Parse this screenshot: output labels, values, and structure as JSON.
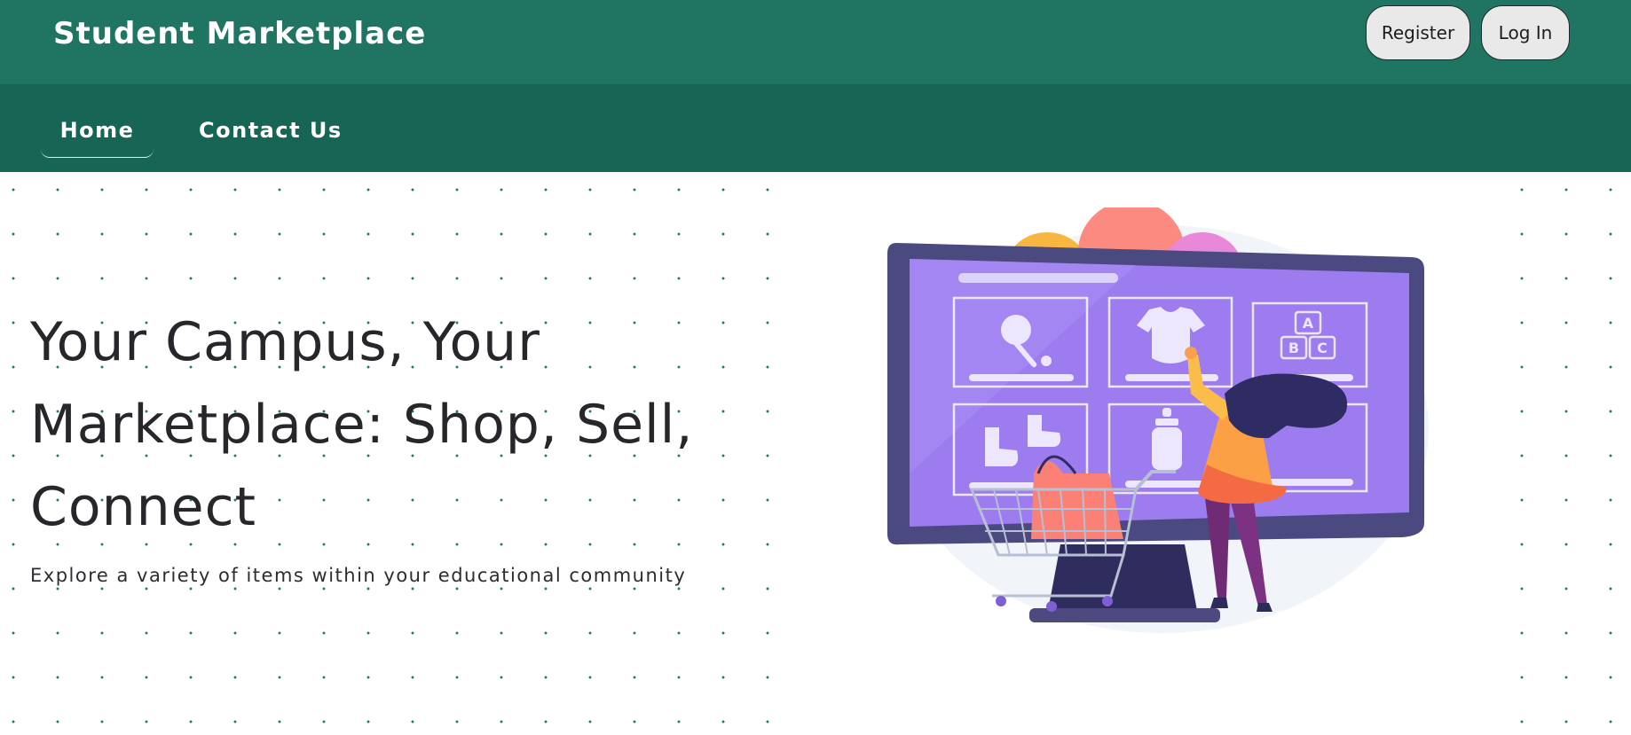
{
  "header": {
    "brand": "Student Marketplace",
    "register_label": "Register",
    "login_label": "Log In"
  },
  "nav": {
    "items": [
      {
        "label": "Home",
        "active": true
      },
      {
        "label": "Contact Us",
        "active": false
      }
    ]
  },
  "hero": {
    "headline": "Your Campus, Your Marketplace: Shop, Sell, Connect",
    "subtitle": "Explore a variety of items within your educational community",
    "illustration": {
      "icons": [
        "rattle-icon",
        "onesie-icon",
        "abc-blocks-icon",
        "baby-shoes-icon",
        "baby-bottle-icon"
      ],
      "block_letters": [
        "A",
        "B",
        "C"
      ]
    }
  },
  "colors": {
    "header_bg": "#207462",
    "nav_bg": "#176554",
    "screen_purple": "#9d7cf0",
    "monitor_frame": "#4a4980"
  }
}
